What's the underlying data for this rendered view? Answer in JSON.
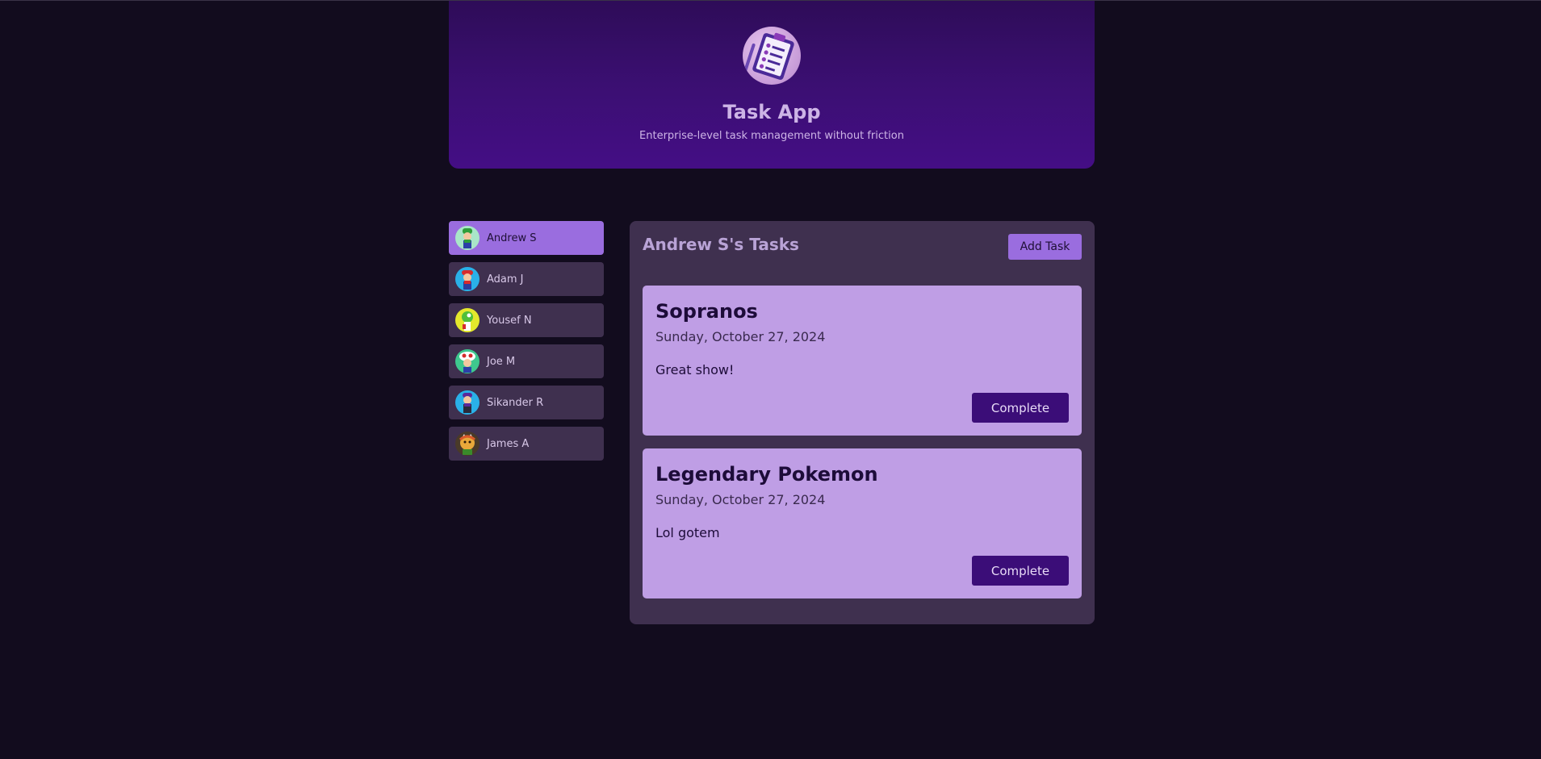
{
  "header": {
    "logo_icon": "clipboard-checklist-icon",
    "title": "Task App",
    "subtitle": "Enterprise-level task management without friction"
  },
  "sidebar": {
    "users": [
      {
        "name": "Andrew S",
        "avatar": "luigi-avatar",
        "active": true
      },
      {
        "name": "Adam J",
        "avatar": "mario-avatar",
        "active": false
      },
      {
        "name": "Yousef N",
        "avatar": "yoshi-avatar",
        "active": false
      },
      {
        "name": "Joe M",
        "avatar": "toad-avatar",
        "active": false
      },
      {
        "name": "Sikander R",
        "avatar": "waluigi-avatar",
        "active": false
      },
      {
        "name": "James A",
        "avatar": "bowser-avatar",
        "active": false
      }
    ]
  },
  "main": {
    "title": "Andrew S's Tasks",
    "add_task_label": "Add Task",
    "tasks": [
      {
        "name": "Sopranos",
        "date": "Sunday, October 27, 2024",
        "description": "Great show!",
        "complete_label": "Complete"
      },
      {
        "name": "Legendary Pokemon",
        "date": "Sunday, October 27, 2024",
        "description": "Lol gotem",
        "complete_label": "Complete"
      }
    ]
  },
  "colors": {
    "background": "#120c1e",
    "header_gradient_top": "#2e0c58",
    "header_gradient_bottom": "#440e85",
    "accent": "#9a6ddf",
    "card": "#bf9ee5",
    "panel": "#3f304f",
    "button_dark": "#3b0d78"
  }
}
